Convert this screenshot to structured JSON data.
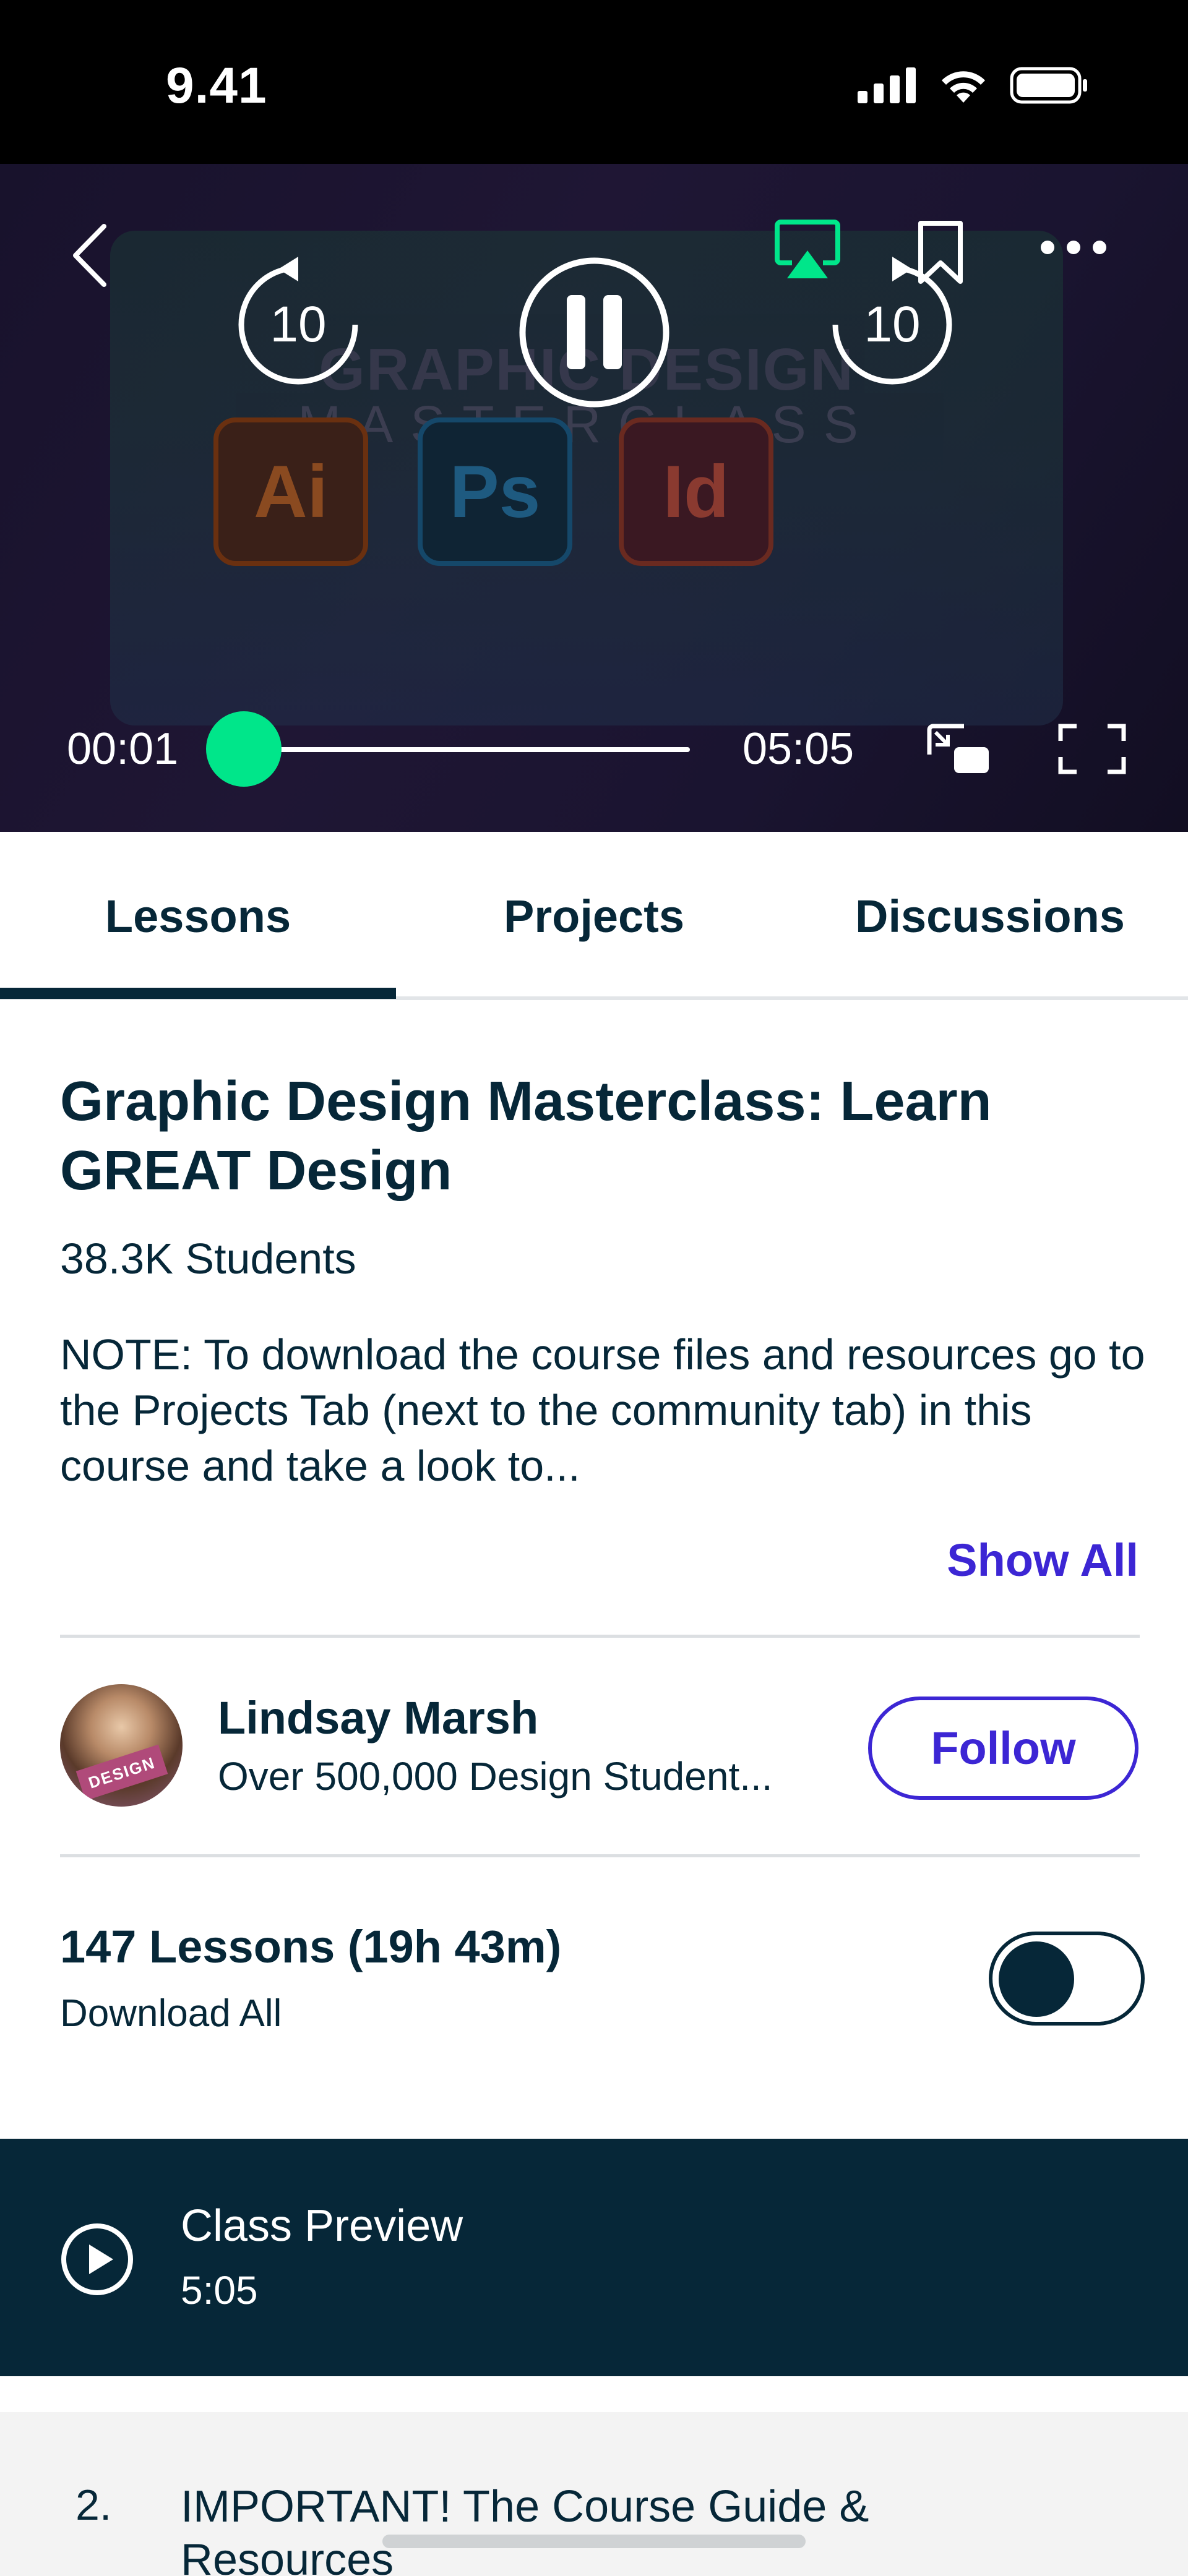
{
  "status_bar": {
    "time": "9.41",
    "icons": [
      "signal-icon",
      "wifi-icon",
      "battery-icon"
    ]
  },
  "player": {
    "thumbnail": {
      "title": "GRAPHIC DESIGN",
      "subtitle": "MASTERCLASS",
      "apps": [
        "Ai",
        "Ps",
        "Id"
      ]
    },
    "rewind_label": "10",
    "forward_label": "10",
    "current_time": "00:01",
    "total_time": "05:05",
    "progress": 0.003,
    "accent_color": "#00e68a"
  },
  "tabs": [
    {
      "label": "Lessons",
      "active": true
    },
    {
      "label": "Projects",
      "active": false
    },
    {
      "label": "Discussions",
      "active": false
    }
  ],
  "course": {
    "title": "Graphic Design Masterclass: Learn GREAT Design",
    "students": "38.3K Students",
    "description": "NOTE: To download the course files and resources go to the Projects Tab (next to the community tab) in this course and take a look to...",
    "show_all": "Show All"
  },
  "instructor": {
    "name": "Lindsay Marsh",
    "subtitle": "Over 500,000 Design Student...",
    "follow_label": "Follow",
    "avatar_badge": "DESIGN"
  },
  "lessons": {
    "count_label": "147 Lessons (19h 43m)",
    "download_all": "Download All",
    "download_toggle_on": false,
    "items": [
      {
        "number": "",
        "title": "Class Preview",
        "duration": "5:05",
        "active": true
      },
      {
        "number": "2.",
        "title": "IMPORTANT! The Course Guide & Resources",
        "duration": "",
        "active": false
      }
    ]
  },
  "colors": {
    "navy": "#062738",
    "link": "#3c26d4",
    "green": "#00e68a"
  }
}
